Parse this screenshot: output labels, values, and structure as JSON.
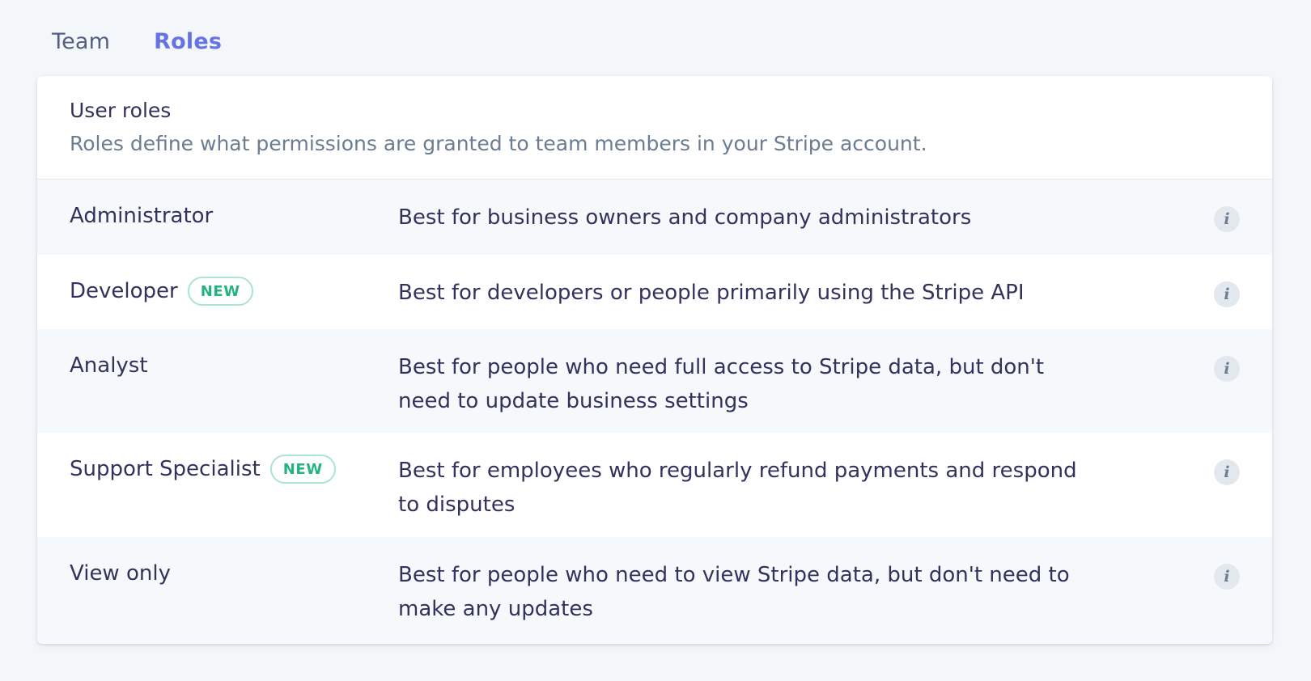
{
  "tabs": [
    {
      "label": "Team",
      "active": false
    },
    {
      "label": "Roles",
      "active": true
    }
  ],
  "card": {
    "title": "User roles",
    "subtitle": "Roles define what permissions are granted to team members in your Stripe account."
  },
  "roles": [
    {
      "name": "Administrator",
      "badge": "",
      "description": "Best for business owners and company administrators",
      "info_icon": "i"
    },
    {
      "name": "Developer",
      "badge": "NEW",
      "description": "Best for developers or people primarily using the Stripe API",
      "info_icon": "i"
    },
    {
      "name": "Analyst",
      "badge": "",
      "description": "Best for people who need full access to Stripe data, but don't need to update business settings",
      "info_icon": "i"
    },
    {
      "name": "Support Specialist",
      "badge": "NEW",
      "description": "Best for employees who regularly refund payments and respond to disputes",
      "info_icon": "i"
    },
    {
      "name": "View only",
      "badge": "",
      "description": "Best for people who need to view Stripe data, but don't need to make any updates",
      "info_icon": "i"
    }
  ],
  "colors": {
    "accent": "#6772e5",
    "badge_green": "#24b47e",
    "text": "#32325d",
    "muted": "#6b7c93",
    "background": "#f4f7fa"
  }
}
